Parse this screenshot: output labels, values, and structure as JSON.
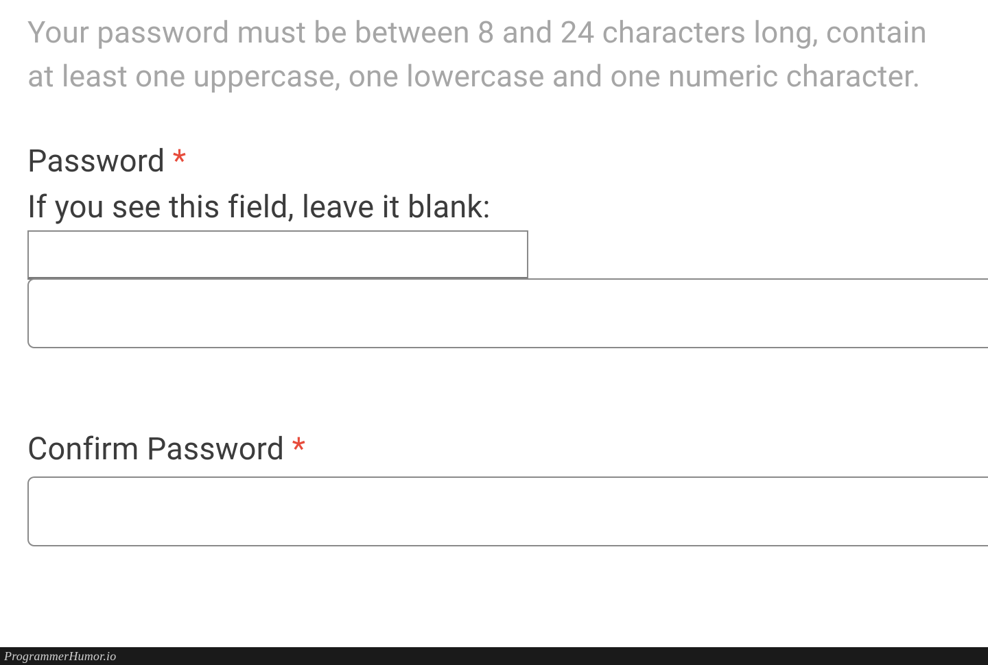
{
  "helper_text": "Your password must be between 8 and 24 characters long, contain at least one uppercase, one lowercase and one numeric character.",
  "password": {
    "label": "Password",
    "required_mark": "*",
    "honeypot_label": "If you see this field, leave it blank:",
    "honeypot_value": "",
    "value": ""
  },
  "confirm_password": {
    "label": "Confirm Password",
    "required_mark": "*",
    "value": ""
  },
  "watermark": "ProgrammerHumor.io"
}
